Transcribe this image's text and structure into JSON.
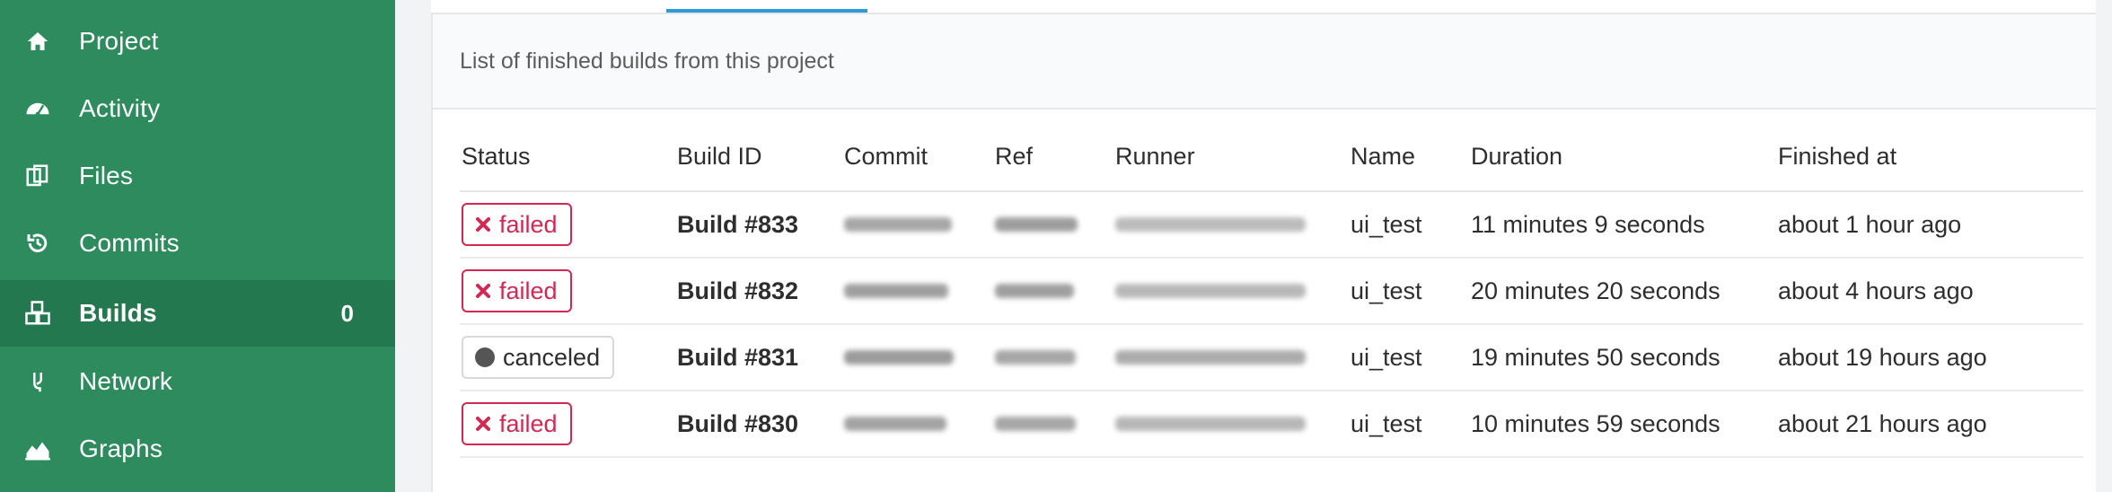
{
  "sidebar": {
    "items": [
      {
        "label": "Project",
        "icon": "home-icon",
        "active": false
      },
      {
        "label": "Activity",
        "icon": "dashboard-icon",
        "active": false
      },
      {
        "label": "Files",
        "icon": "files-icon",
        "active": false
      },
      {
        "label": "Commits",
        "icon": "history-icon",
        "active": false
      },
      {
        "label": "Builds",
        "icon": "cubes-icon",
        "active": true,
        "count": "0"
      },
      {
        "label": "Network",
        "icon": "code-fork-icon",
        "active": false
      },
      {
        "label": "Graphs",
        "icon": "area-chart-icon",
        "active": false
      }
    ],
    "colors": {
      "background": "#2d8b5e",
      "active_background": "#24784f",
      "text": "#ffffff"
    }
  },
  "panel": {
    "heading": "List of finished builds from this project"
  },
  "table": {
    "columns": [
      "Status",
      "Build ID",
      "Commit",
      "Ref",
      "Runner",
      "Name",
      "Duration",
      "Finished at"
    ],
    "rows": [
      {
        "status": "failed",
        "build_id": "Build #833",
        "name": "ui_test",
        "duration": "11 minutes 9 seconds",
        "finished_at": "about 1 hour ago"
      },
      {
        "status": "failed",
        "build_id": "Build #832",
        "name": "ui_test",
        "duration": "20 minutes 20 seconds",
        "finished_at": "about 4 hours ago"
      },
      {
        "status": "canceled",
        "build_id": "Build #831",
        "name": "ui_test",
        "duration": "19 minutes 50 seconds",
        "finished_at": "about 19 hours ago"
      },
      {
        "status": "failed",
        "build_id": "Build #830",
        "name": "ui_test",
        "duration": "10 minutes 59 seconds",
        "finished_at": "about 21 hours ago"
      }
    ]
  },
  "colors": {
    "failed": "#d22852",
    "accent_tab": "#2d9bd6"
  }
}
